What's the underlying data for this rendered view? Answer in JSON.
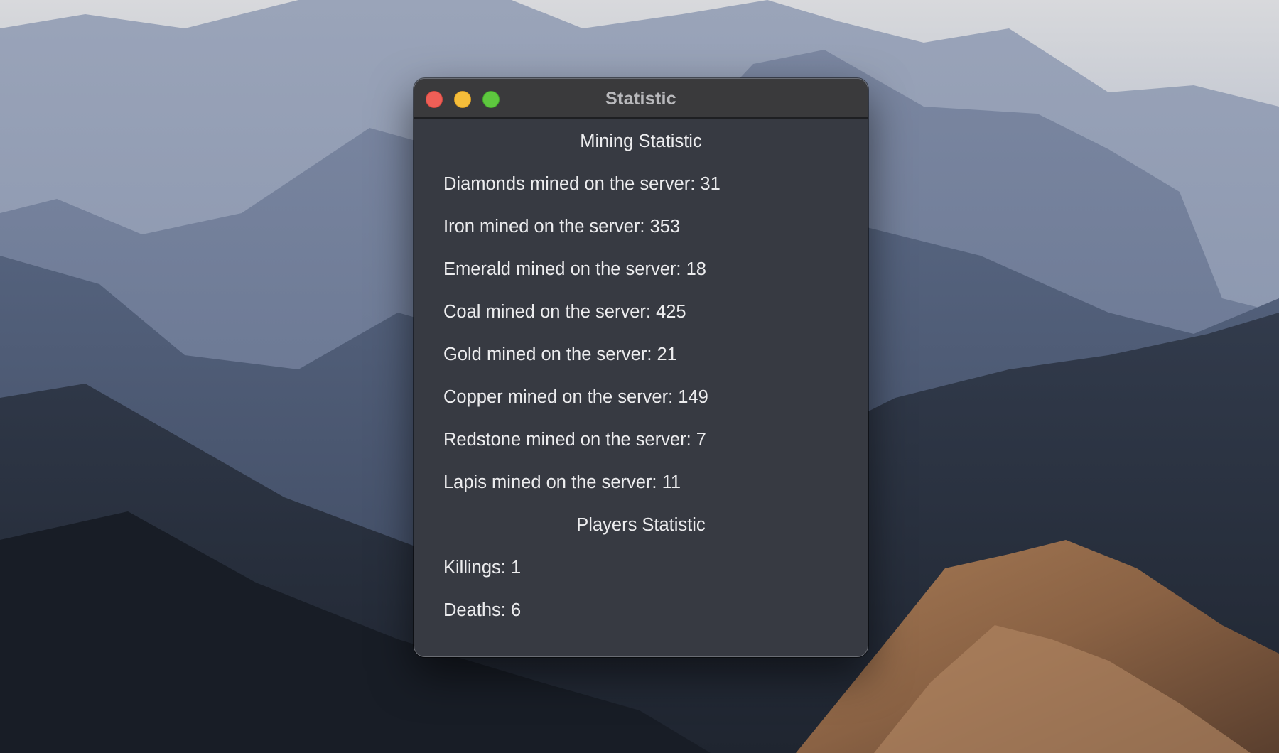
{
  "window": {
    "title": "Statistic"
  },
  "mining": {
    "heading": "Mining Statistic",
    "rows": [
      "Diamonds mined on the server: 31",
      "Iron mined on the server: 353",
      "Emerald mined on the server: 18",
      "Coal mined on the server: 425",
      "Gold mined on the server: 21",
      "Copper mined on the server: 149",
      "Redstone mined on the server: 7",
      "Lapis mined on the server: 11"
    ]
  },
  "players": {
    "heading": "Players Statistic",
    "rows": [
      "Killings: 1",
      "Deaths: 6"
    ]
  },
  "colors": {
    "window_bg": "#373a42",
    "titlebar_bg": "#3a3a3c",
    "close": "#ee5f57",
    "minimize": "#f5bd3a",
    "zoom": "#5ec73f",
    "text": "#ececee"
  }
}
